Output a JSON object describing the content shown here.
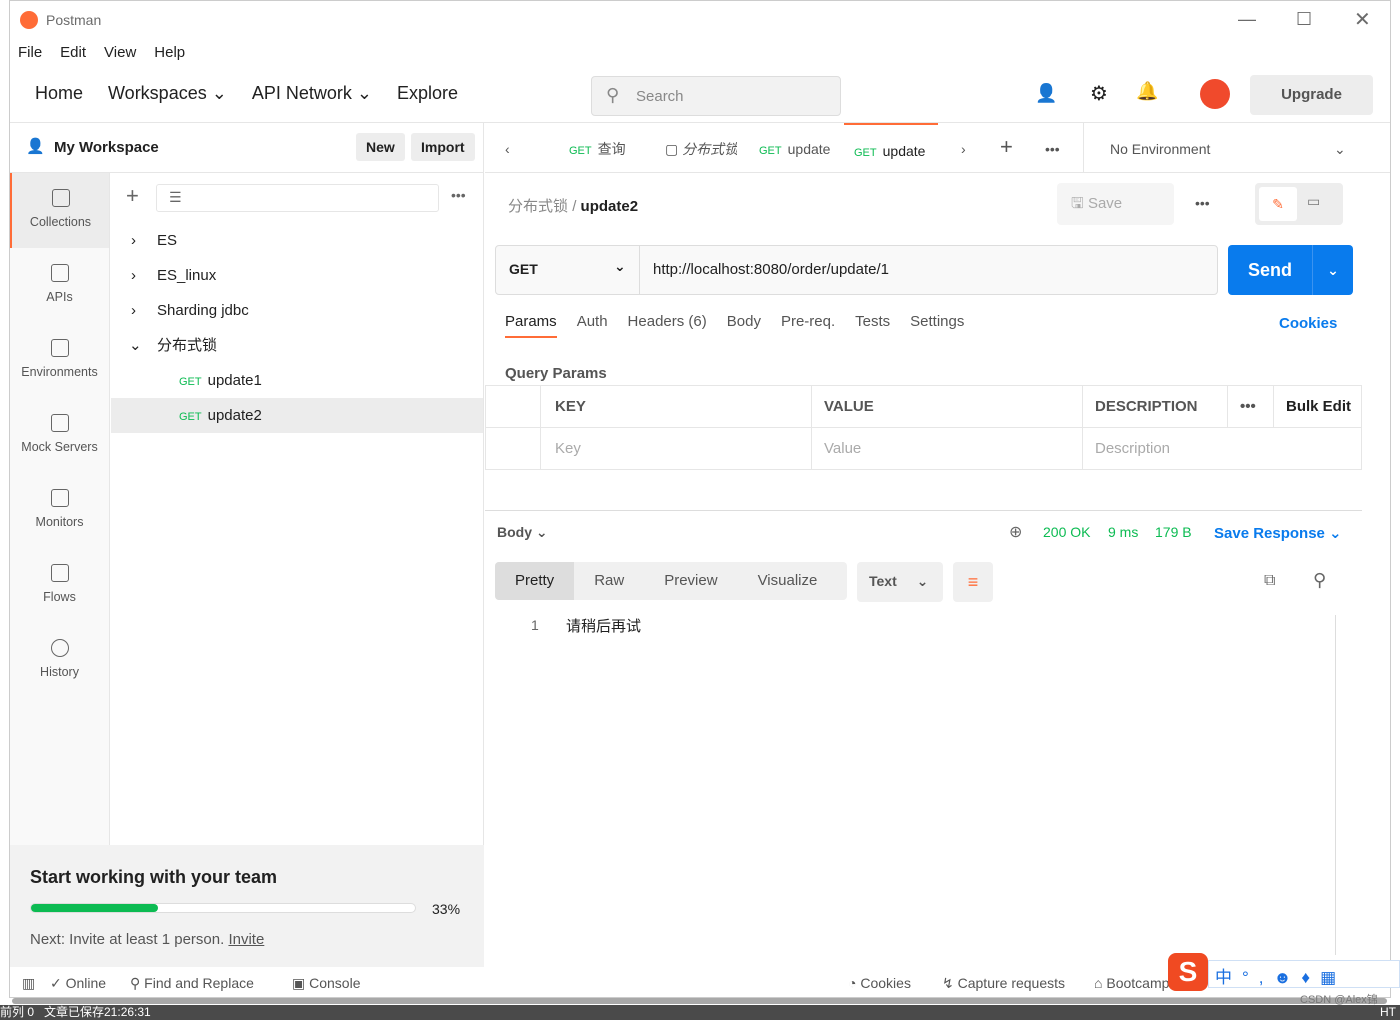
{
  "app": {
    "title": "Postman"
  },
  "menu": [
    "File",
    "Edit",
    "View",
    "Help"
  ],
  "nav": {
    "home": "Home",
    "workspaces": "Workspaces",
    "api_network": "API Network",
    "explore": "Explore",
    "search_placeholder": "Search",
    "upgrade": "Upgrade"
  },
  "workspace": {
    "name": "My Workspace",
    "new": "New",
    "import": "Import"
  },
  "rail": [
    "Collections",
    "APIs",
    "Environments",
    "Mock Servers",
    "Monitors",
    "Flows",
    "History"
  ],
  "tree": [
    {
      "label": "ES"
    },
    {
      "label": "ES_linux"
    },
    {
      "label": "Sharding jdbc"
    },
    {
      "label": "分布式锁"
    },
    {
      "method": "GET",
      "label": "update1"
    },
    {
      "method": "GET",
      "label": "update2"
    }
  ],
  "team": {
    "title": "Start working with your team",
    "progress_percent": 33,
    "progress_label": "33%",
    "next": "Next: Invite at least 1 person.",
    "invite": "Invite"
  },
  "tabs": [
    {
      "method": "GET",
      "label": "查询"
    },
    {
      "label": "分布式锁"
    },
    {
      "method": "GET",
      "label": "update"
    },
    {
      "method": "GET",
      "label": "update"
    }
  ],
  "environment": "No Environment",
  "breadcrumb": {
    "parent": "分布式锁",
    "sep": "/",
    "current": "update2"
  },
  "save": "Save",
  "request": {
    "method": "GET",
    "url": "http://localhost:8080/order/update/1",
    "send": "Send"
  },
  "req_tabs": [
    "Params",
    "Auth",
    "Headers (6)",
    "Body",
    "Pre-req.",
    "Tests",
    "Settings"
  ],
  "cookies": "Cookies",
  "query_params": "Query Params",
  "params_table": {
    "headers": [
      "KEY",
      "VALUE",
      "DESCRIPTION",
      "Bulk Edit"
    ],
    "placeholders": [
      "Key",
      "Value",
      "Description"
    ]
  },
  "response": {
    "body": "Body",
    "status": "200 OK",
    "time": "9 ms",
    "size": "179 B",
    "save": "Save Response",
    "tabs": [
      "Pretty",
      "Raw",
      "Preview",
      "Visualize"
    ],
    "format": "Text",
    "line": "1",
    "content": "请稍后再试"
  },
  "statusbar": {
    "online": "Online",
    "find": "Find and Replace",
    "console": "Console",
    "cookies": "Cookies",
    "capture": "Capture requests",
    "bootcamp": "Bootcamp"
  },
  "taskbar": {
    "left": "前列 0   文章已保存21:26:31",
    "right": "HT",
    "watermark": "CSDN @Alex锦"
  },
  "colors": {
    "accent": "#ff6c37",
    "send": "#097bed",
    "get": "#0cbb52",
    "progress": "#0cbb52"
  }
}
